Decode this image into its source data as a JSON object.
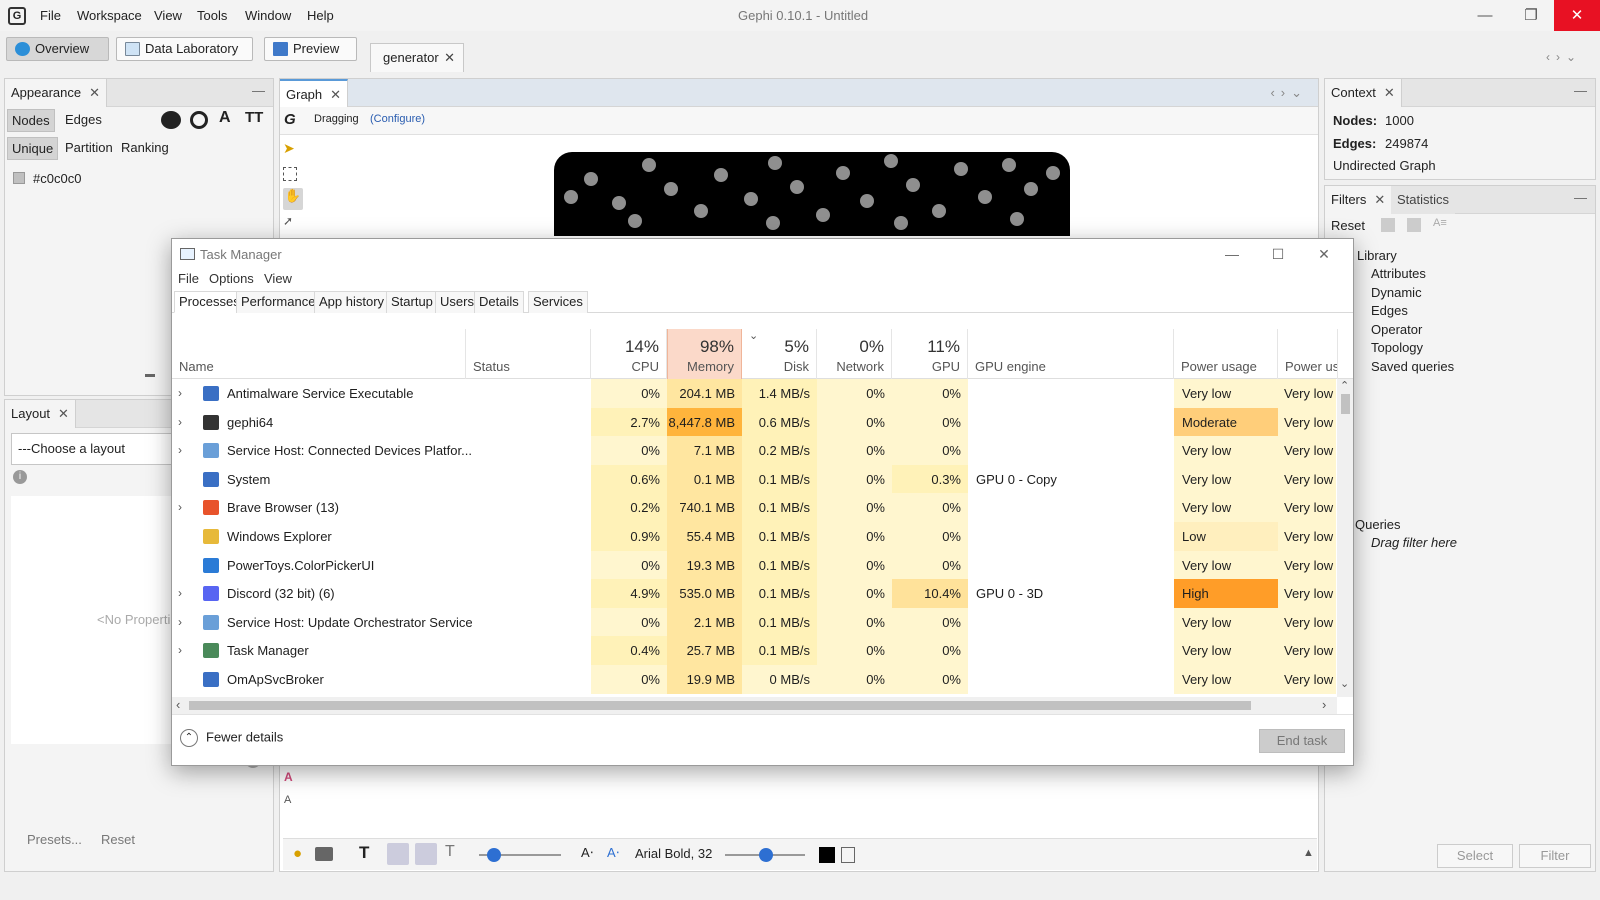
{
  "app": {
    "title": "Gephi 0.10.1 - Untitled",
    "menu": [
      "File",
      "Workspace",
      "View",
      "Tools",
      "Window",
      "Help"
    ]
  },
  "toolbar": {
    "overview": "Overview",
    "data_laboratory": "Data Laboratory",
    "preview": "Preview",
    "workspace_tab": "generator"
  },
  "appearance": {
    "tab": "Appearance",
    "nodes": "Nodes",
    "edges": "Edges",
    "unique": "Unique",
    "partition": "Partition",
    "ranking": "Ranking",
    "color_value": "#c0c0c0",
    "color_hex": "#c0c0c0"
  },
  "layout": {
    "tab": "Layout",
    "choose": "---Choose a layout",
    "no_properties": "<No Properties>",
    "presets": "Presets...",
    "reset": "Reset"
  },
  "graph": {
    "tab": "Graph",
    "mode": "Dragging",
    "configure": "(Configure)",
    "font": "Arial Bold, 32"
  },
  "context": {
    "tab": "Context",
    "nodes_label": "Nodes:",
    "nodes_value": "1000",
    "edges_label": "Edges:",
    "edges_value": "249874",
    "graph_type": "Undirected Graph"
  },
  "filters": {
    "tab": "Filters",
    "statistics_tab": "Statistics",
    "reset": "Reset",
    "library": "Library",
    "items": [
      "Attributes",
      "Dynamic",
      "Edges",
      "Operator",
      "Topology",
      "Saved queries"
    ],
    "queries": "Queries",
    "drag_hint": "Drag filter here",
    "select": "Select",
    "filter": "Filter"
  },
  "taskmanager": {
    "title": "Task Manager",
    "menu": [
      "File",
      "Options",
      "View"
    ],
    "tabs": [
      "Processes",
      "Performance",
      "App history",
      "Startup",
      "Users",
      "Details",
      "Services"
    ],
    "columns": {
      "name": "Name",
      "status": "Status",
      "cpu_pct": "14%",
      "cpu": "CPU",
      "mem_pct": "98%",
      "mem": "Memory",
      "disk_pct": "5%",
      "disk": "Disk",
      "net_pct": "0%",
      "net": "Network",
      "gpu_pct": "11%",
      "gpu": "GPU",
      "gpu_engine": "GPU engine",
      "power": "Power usage",
      "power_trend": "Power usag"
    },
    "rows": [
      {
        "name": "Antimalware Service Executable",
        "exp": true,
        "icon": "#3a6fc4",
        "cpu": "0%",
        "mem": "204.1 MB",
        "disk": "1.4 MB/s",
        "net": "0%",
        "gpu": "0%",
        "engine": "",
        "power": "Very low",
        "trend": "Very low"
      },
      {
        "name": "gephi64",
        "exp": true,
        "icon": "#333333",
        "cpu": "2.7%",
        "mem": "8,447.8 MB",
        "disk": "0.6 MB/s",
        "net": "0%",
        "gpu": "0%",
        "engine": "",
        "power": "Moderate",
        "trend": "Very low"
      },
      {
        "name": "Service Host: Connected Devices Platfor...",
        "exp": true,
        "icon": "#6a9fd8",
        "cpu": "0%",
        "mem": "7.1 MB",
        "disk": "0.2 MB/s",
        "net": "0%",
        "gpu": "0%",
        "engine": "",
        "power": "Very low",
        "trend": "Very low"
      },
      {
        "name": "System",
        "exp": false,
        "icon": "#3a6fc4",
        "cpu": "0.6%",
        "mem": "0.1 MB",
        "disk": "0.1 MB/s",
        "net": "0%",
        "gpu": "0.3%",
        "engine": "GPU 0 - Copy",
        "power": "Very low",
        "trend": "Very low"
      },
      {
        "name": "Brave Browser (13)",
        "exp": true,
        "icon": "#e8532b",
        "cpu": "0.2%",
        "mem": "740.1 MB",
        "disk": "0.1 MB/s",
        "net": "0%",
        "gpu": "0%",
        "engine": "",
        "power": "Very low",
        "trend": "Very low"
      },
      {
        "name": "Windows Explorer",
        "exp": false,
        "icon": "#e7b93a",
        "cpu": "0.9%",
        "mem": "55.4 MB",
        "disk": "0.1 MB/s",
        "net": "0%",
        "gpu": "0%",
        "engine": "",
        "power": "Low",
        "trend": "Very low"
      },
      {
        "name": "PowerToys.ColorPickerUI",
        "exp": false,
        "icon": "#2b7bd6",
        "cpu": "0%",
        "mem": "19.3 MB",
        "disk": "0.1 MB/s",
        "net": "0%",
        "gpu": "0%",
        "engine": "",
        "power": "Very low",
        "trend": "Very low"
      },
      {
        "name": "Discord (32 bit) (6)",
        "exp": true,
        "icon": "#5865f2",
        "cpu": "4.9%",
        "mem": "535.0 MB",
        "disk": "0.1 MB/s",
        "net": "0%",
        "gpu": "10.4%",
        "engine": "GPU 0 - 3D",
        "power": "High",
        "trend": "Very low"
      },
      {
        "name": "Service Host: Update Orchestrator Service",
        "exp": true,
        "icon": "#6a9fd8",
        "cpu": "0%",
        "mem": "2.1 MB",
        "disk": "0.1 MB/s",
        "net": "0%",
        "gpu": "0%",
        "engine": "",
        "power": "Very low",
        "trend": "Very low"
      },
      {
        "name": "Task Manager",
        "exp": true,
        "icon": "#4a8a5a",
        "cpu": "0.4%",
        "mem": "25.7 MB",
        "disk": "0.1 MB/s",
        "net": "0%",
        "gpu": "0%",
        "engine": "",
        "power": "Very low",
        "trend": "Very low"
      },
      {
        "name": "OmApSvcBroker",
        "exp": false,
        "icon": "#3a6fc4",
        "cpu": "0%",
        "mem": "19.9 MB",
        "disk": "0 MB/s",
        "net": "0%",
        "gpu": "0%",
        "engine": "",
        "power": "Very low",
        "trend": "Very low"
      }
    ],
    "fewer_details": "Fewer details",
    "end_task": "End task"
  }
}
